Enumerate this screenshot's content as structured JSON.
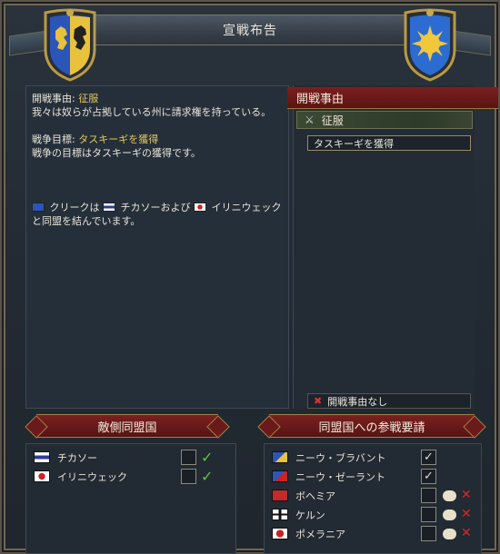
{
  "window": {
    "title": "宣戦布告"
  },
  "left_text": {
    "cb_label": "開戦事由: ",
    "cb_value": "征服",
    "cb_desc": "我々は奴らが占拠している州に請求権を持っている。",
    "goal_label": "戦争目標: ",
    "goal_value": "タスキーギを獲得",
    "goal_desc": "戦争の目標はタスキーギの獲得です。",
    "alliance_a": "クリークは",
    "alliance_b": "チカソーおよび",
    "alliance_c": "イリニウェックと同盟を結んでいます。"
  },
  "casus_belli": {
    "header": "開戦事由",
    "selected": "征服",
    "selected_icon": "crossed-swords-icon",
    "goal_button": "タスキーギを獲得",
    "no_cb_button": "開戦事由なし"
  },
  "enemy_allies": {
    "header": "敵側同盟国",
    "items": [
      {
        "name": "チカソー",
        "checked": true
      },
      {
        "name": "イリニウェック",
        "checked": true
      }
    ]
  },
  "call_allies": {
    "header": "同盟国への参戦要請",
    "items": [
      {
        "name": "ニーウ・ブラバント",
        "checked": true
      },
      {
        "name": "ニーウ・ゼーラント",
        "checked": true
      },
      {
        "name": "ボヘミア",
        "checked": false
      },
      {
        "name": "ケルン",
        "checked": false
      },
      {
        "name": "ポメラニア",
        "checked": false
      }
    ]
  },
  "colors": {
    "gold_text": "#e3c75a",
    "header_red": "#7a2020",
    "tick_green": "#5fc444",
    "cross_red": "#d42a2a"
  }
}
